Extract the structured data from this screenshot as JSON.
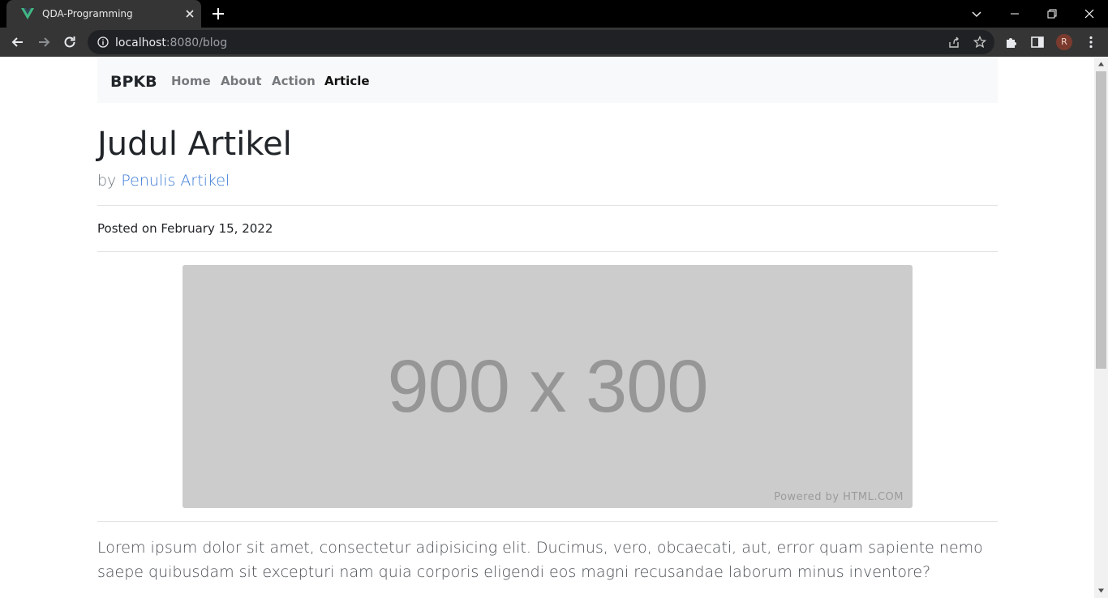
{
  "browser": {
    "tab_title": "QDA-Programming",
    "url_host": "localhost",
    "url_path": ":8080/blog",
    "profile_initial": "R"
  },
  "site": {
    "brand": "BPKB",
    "nav": [
      {
        "label": "Home",
        "active": false
      },
      {
        "label": "About",
        "active": false
      },
      {
        "label": "Action",
        "active": false
      },
      {
        "label": "Article",
        "active": true
      }
    ]
  },
  "article": {
    "title": "Judul Artikel",
    "by_prefix": "by",
    "author": "Penulis Artikel",
    "posted": "Posted on February 15, 2022",
    "image": {
      "label": "900 x 300",
      "powered": "Powered by HTML.COM"
    },
    "body": "Lorem ipsum dolor sit amet, consectetur adipisicing elit. Ducimus, vero, obcaecati, aut, error quam sapiente nemo saepe quibusdam sit excepturi nam quia corporis eligendi eos magni recusandae laborum minus inventore?"
  },
  "colors": {
    "link": "#3a7bd5",
    "navbar_bg": "#f8f9fa",
    "placeholder_bg": "#cccccc"
  }
}
